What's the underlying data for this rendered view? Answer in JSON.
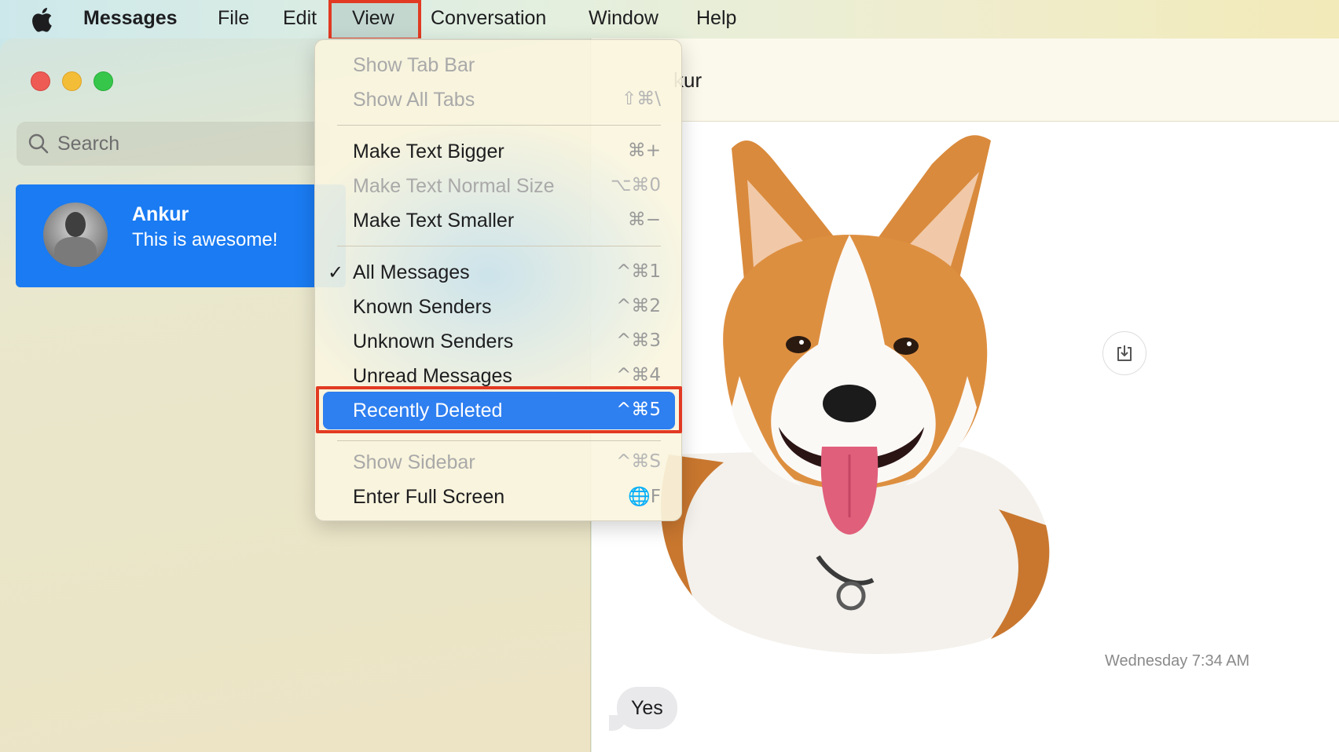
{
  "menubar": {
    "app_name": "Messages",
    "items": [
      "File",
      "Edit",
      "View",
      "Conversation",
      "Window",
      "Help"
    ]
  },
  "sidebar": {
    "search_placeholder": "Search",
    "conversation": {
      "name": "Ankur",
      "preview": "This is awesome!"
    }
  },
  "detail": {
    "title": "kur",
    "timestamp": "Wednesday 7:34 AM",
    "message": "Yes"
  },
  "view_menu": {
    "items": [
      {
        "label": "Show Tab Bar",
        "shortcut": "",
        "disabled": true
      },
      {
        "label": "Show All Tabs",
        "shortcut": "⇧⌘\\",
        "disabled": true
      },
      {
        "label": "Make Text Bigger",
        "shortcut": "⌘+",
        "disabled": false
      },
      {
        "label": "Make Text Normal Size",
        "shortcut": "⌥⌘0",
        "disabled": true
      },
      {
        "label": "Make Text Smaller",
        "shortcut": "⌘−",
        "disabled": false
      },
      {
        "label": "All Messages",
        "shortcut": "^⌘1",
        "checked": true
      },
      {
        "label": "Known Senders",
        "shortcut": "^⌘2"
      },
      {
        "label": "Unknown Senders",
        "shortcut": "^⌘3"
      },
      {
        "label": "Unread Messages",
        "shortcut": "^⌘4"
      },
      {
        "label": "Recently Deleted",
        "shortcut": "^⌘5",
        "highlighted": true
      },
      {
        "label": "Show Sidebar",
        "shortcut": "^⌘S",
        "disabled": true
      },
      {
        "label": "Enter Full Screen",
        "shortcut": "🌐F"
      }
    ]
  },
  "colors": {
    "highlight": "#2e7ff0",
    "annotation": "#e23a22",
    "selected_conversation": "#1a7bf2"
  }
}
